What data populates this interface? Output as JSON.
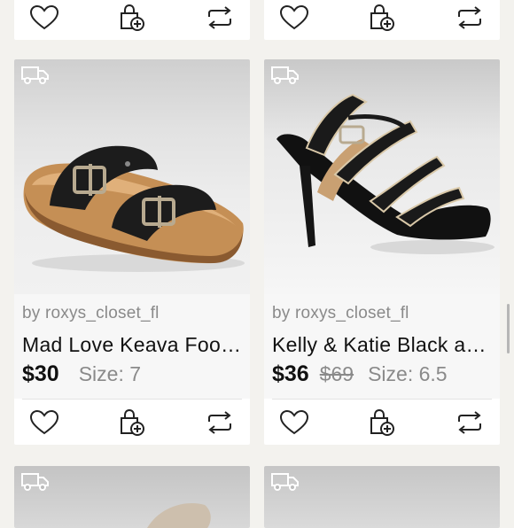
{
  "products": [
    {
      "seller": "by roxys_closet_fl",
      "title": "Mad Love Keava Foo…",
      "price": "$30",
      "original_price": "",
      "size": "Size: 7"
    },
    {
      "seller": "by roxys_closet_fl",
      "title": "Kelly & Katie Black a…",
      "price": "$36",
      "original_price": "$69",
      "size": "Size: 6.5"
    }
  ],
  "icons": {
    "like": "heart-icon",
    "bundle": "bag-add-icon",
    "share": "share-repeat-icon",
    "shipping": "truck-icon"
  },
  "colors": {
    "background": "#f3f2ee",
    "card": "#ffffff",
    "info_panel": "#f7f7f7",
    "text": "#111111",
    "muted": "#8a8a8a"
  }
}
